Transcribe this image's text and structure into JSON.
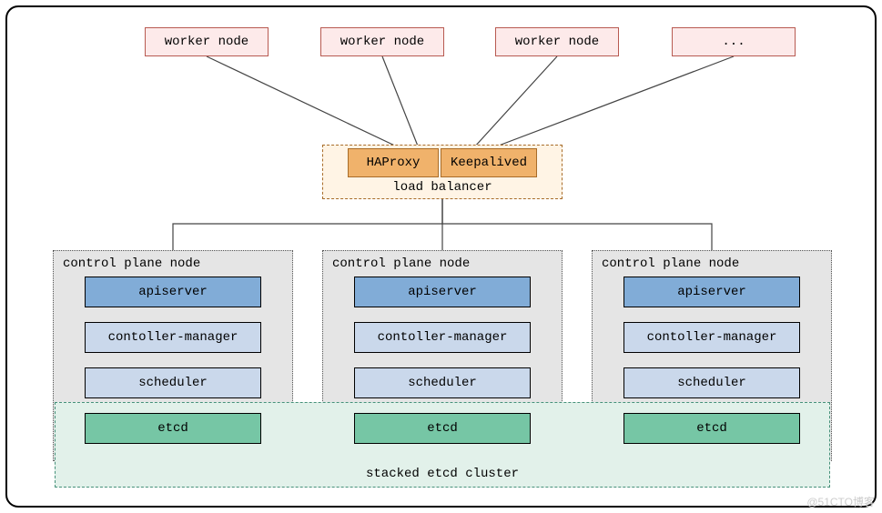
{
  "workers": {
    "w1": "worker node",
    "w2": "worker node",
    "w3": "worker node",
    "w4": "..."
  },
  "lb": {
    "haproxy": "HAProxy",
    "keepalived": "Keepalived",
    "group_label": "load balancer"
  },
  "control_plane": {
    "group_label": "control plane node",
    "components": {
      "apiserver": "apiserver",
      "controller_manager": "contoller-manager",
      "scheduler": "scheduler",
      "etcd": "etcd"
    }
  },
  "etcd_cluster": {
    "label": "stacked etcd cluster"
  },
  "watermark": "@51CTO博客"
}
